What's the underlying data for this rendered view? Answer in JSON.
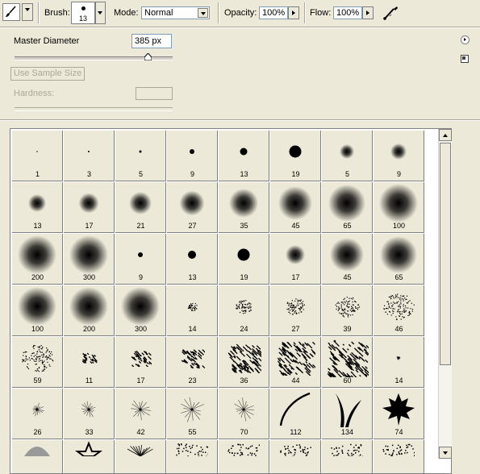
{
  "options_bar": {
    "brush_label": "Brush:",
    "brush_size": "13",
    "mode_label": "Mode:",
    "mode_value": "Normal",
    "opacity_label": "Opacity:",
    "opacity_value": "100%",
    "flow_label": "Flow:",
    "flow_value": "100%",
    "tool_icon": "brush-icon",
    "airbrush_icon": "airbrush-icon"
  },
  "panel": {
    "master_diameter_label": "Master Diameter",
    "master_diameter_value": "385 px",
    "master_diameter_slider_fraction": 0.84,
    "use_sample_size_label": "Use Sample Size",
    "hardness_label": "Hardness:"
  },
  "brushes": [
    {
      "label": "1",
      "kind": "hard",
      "d": 1.5
    },
    {
      "label": "3",
      "kind": "hard",
      "d": 2
    },
    {
      "label": "5",
      "kind": "hard",
      "d": 3
    },
    {
      "label": "9",
      "kind": "hard",
      "d": 6
    },
    {
      "label": "13",
      "kind": "hard",
      "d": 9
    },
    {
      "label": "19",
      "kind": "hard",
      "d": 15
    },
    {
      "label": "5",
      "kind": "soft",
      "d": 4
    },
    {
      "label": "9",
      "kind": "soft",
      "d": 6
    },
    {
      "label": "13",
      "kind": "soft",
      "d": 8
    },
    {
      "label": "17",
      "kind": "soft",
      "d": 11
    },
    {
      "label": "21",
      "kind": "soft",
      "d": 14
    },
    {
      "label": "27",
      "kind": "soft",
      "d": 17
    },
    {
      "label": "35",
      "kind": "soft",
      "d": 22
    },
    {
      "label": "45",
      "kind": "soft",
      "d": 28
    },
    {
      "label": "65",
      "kind": "soft",
      "d": 32
    },
    {
      "label": "100",
      "kind": "soft",
      "d": 34
    },
    {
      "label": "200",
      "kind": "soft",
      "d": 34
    },
    {
      "label": "300",
      "kind": "soft",
      "d": 34
    },
    {
      "label": "9",
      "kind": "hard",
      "d": 6
    },
    {
      "label": "13",
      "kind": "hard",
      "d": 10
    },
    {
      "label": "19",
      "kind": "hard",
      "d": 15
    },
    {
      "label": "17",
      "kind": "soft",
      "d": 10
    },
    {
      "label": "45",
      "kind": "soft",
      "d": 28
    },
    {
      "label": "65",
      "kind": "soft",
      "d": 32
    },
    {
      "label": "100",
      "kind": "soft",
      "d": 34
    },
    {
      "label": "200",
      "kind": "soft",
      "d": 34
    },
    {
      "label": "300",
      "kind": "soft",
      "d": 34
    },
    {
      "label": "14",
      "kind": "scatter",
      "d": 12
    },
    {
      "label": "24",
      "kind": "scatter",
      "d": 20
    },
    {
      "label": "27",
      "kind": "scatter",
      "d": 24
    },
    {
      "label": "39",
      "kind": "scatter",
      "d": 30
    },
    {
      "label": "46",
      "kind": "scatter",
      "d": 38
    },
    {
      "label": "59",
      "kind": "scatter",
      "d": 40
    },
    {
      "label": "11",
      "kind": "chalk",
      "d": 12
    },
    {
      "label": "17",
      "kind": "chalk",
      "d": 18
    },
    {
      "label": "23",
      "kind": "chalk",
      "d": 22
    },
    {
      "label": "36",
      "kind": "chalk",
      "d": 34
    },
    {
      "label": "44",
      "kind": "chalk",
      "d": 40
    },
    {
      "label": "60",
      "kind": "chalk",
      "d": 44
    },
    {
      "label": "14",
      "kind": "star",
      "d": 6
    },
    {
      "label": "26",
      "kind": "star",
      "d": 18
    },
    {
      "label": "33",
      "kind": "star",
      "d": 22
    },
    {
      "label": "42",
      "kind": "star",
      "d": 30
    },
    {
      "label": "55",
      "kind": "star",
      "d": 34
    },
    {
      "label": "70",
      "kind": "star",
      "d": 30
    },
    {
      "label": "112",
      "kind": "stroke",
      "d": 40
    },
    {
      "label": "134",
      "kind": "grass",
      "d": 40
    },
    {
      "label": "74",
      "kind": "leaf",
      "d": 40
    },
    {
      "label": "",
      "kind": "partial",
      "d": 30
    },
    {
      "label": "",
      "kind": "partial",
      "d": 30
    },
    {
      "label": "",
      "kind": "partial",
      "d": 30
    },
    {
      "label": "",
      "kind": "partial",
      "d": 30
    },
    {
      "label": "",
      "kind": "partial",
      "d": 30
    },
    {
      "label": "",
      "kind": "partial",
      "d": 30
    },
    {
      "label": "",
      "kind": "partial",
      "d": 30
    },
    {
      "label": "",
      "kind": "partial",
      "d": 30
    }
  ]
}
